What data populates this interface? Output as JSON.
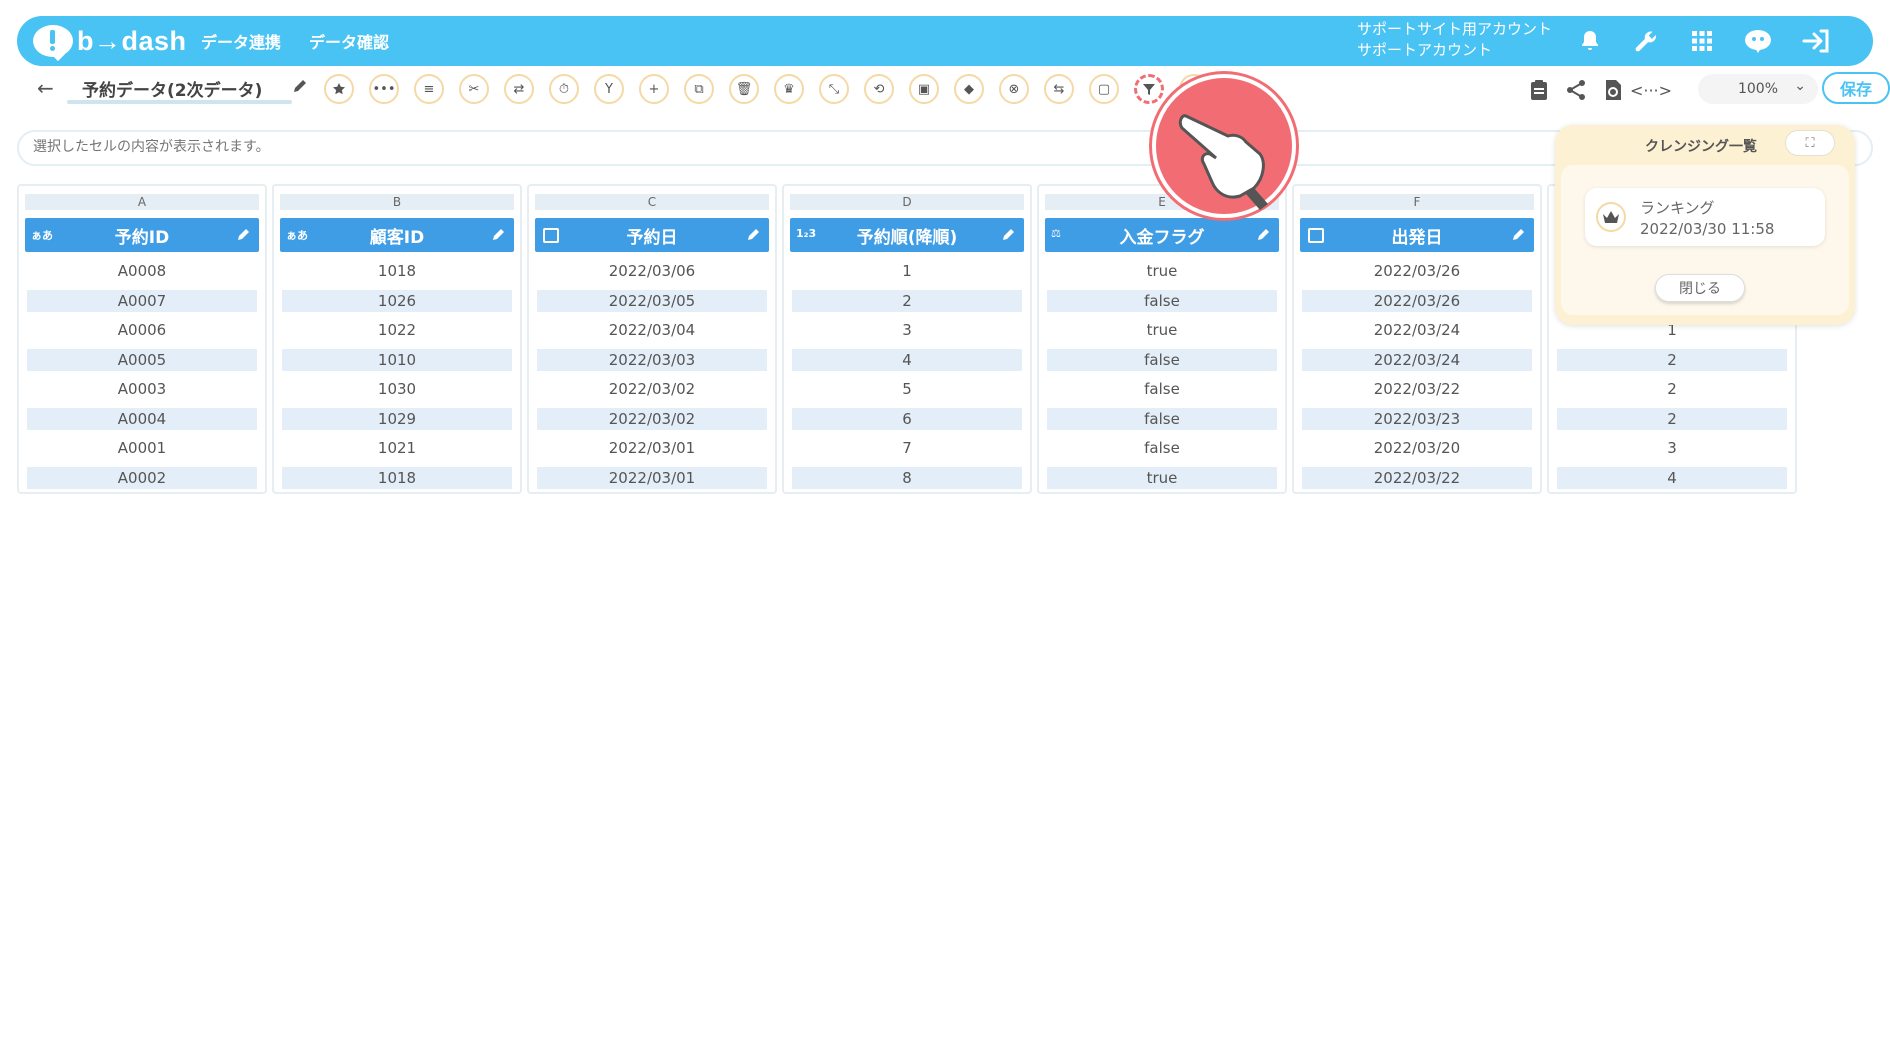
{
  "app": {
    "brand": "b→dash",
    "accent": "#49c3f4",
    "header_blue": "#3f9de6",
    "highlight": "#f26d73"
  },
  "header": {
    "nav": [
      "データ連携",
      "データ確認"
    ],
    "account_line1": "サポートサイト用アカウント",
    "account_line2": "サポートアカウント",
    "icons": [
      "bell-icon",
      "wrench-icon",
      "grid-icon",
      "mascot-icon",
      "logout-icon"
    ]
  },
  "toolbar": {
    "dataset_name": "予約データ(2次データ)",
    "tools": [
      "star",
      "ellipsis",
      "list",
      "scissors",
      "merge",
      "timer",
      "branch",
      "plus",
      "copy",
      "trash",
      "crown",
      "collapse",
      "repeat",
      "lock-data",
      "cube",
      "cancel",
      "replace",
      "frame",
      "filter",
      "extra"
    ],
    "zoom": "100%",
    "save_label": "保存"
  },
  "cellbar": {
    "placeholder": "選択したセルの内容が表示されます。"
  },
  "table": {
    "columns": [
      {
        "letter": "A",
        "name": "予約ID",
        "type": "ぁあ",
        "values": [
          "A0008",
          "A0007",
          "A0006",
          "A0005",
          "A0003",
          "A0004",
          "A0001",
          "A0002"
        ]
      },
      {
        "letter": "B",
        "name": "顧客ID",
        "type": "ぁあ",
        "values": [
          "1018",
          "1026",
          "1022",
          "1010",
          "1030",
          "1029",
          "1021",
          "1018"
        ]
      },
      {
        "letter": "C",
        "name": "予約日",
        "type": "date",
        "values": [
          "2022/03/06",
          "2022/03/05",
          "2022/03/04",
          "2022/03/03",
          "2022/03/02",
          "2022/03/02",
          "2022/03/01",
          "2022/03/01"
        ]
      },
      {
        "letter": "D",
        "name": "予約順(降順)",
        "type": "1₂3",
        "values": [
          "1",
          "2",
          "3",
          "4",
          "5",
          "6",
          "7",
          "8"
        ]
      },
      {
        "letter": "E",
        "name": "入金フラグ",
        "type": "bool",
        "values": [
          "true",
          "false",
          "true",
          "false",
          "false",
          "false",
          "false",
          "true"
        ]
      },
      {
        "letter": "F",
        "name": "出発日",
        "type": "date",
        "values": [
          "2022/03/26",
          "2022/03/26",
          "2022/03/24",
          "2022/03/24",
          "2022/03/22",
          "2022/03/23",
          "2022/03/20",
          "2022/03/22"
        ]
      },
      {
        "letter": "",
        "name": "",
        "type": "",
        "values": [
          "",
          "",
          "1",
          "2",
          "2",
          "2",
          "3",
          "4"
        ]
      }
    ]
  },
  "panel": {
    "title": "クレンジング一覧",
    "item_name": "ランキング",
    "item_time": "2022/03/30 11:58",
    "close_label": "閉じる"
  }
}
